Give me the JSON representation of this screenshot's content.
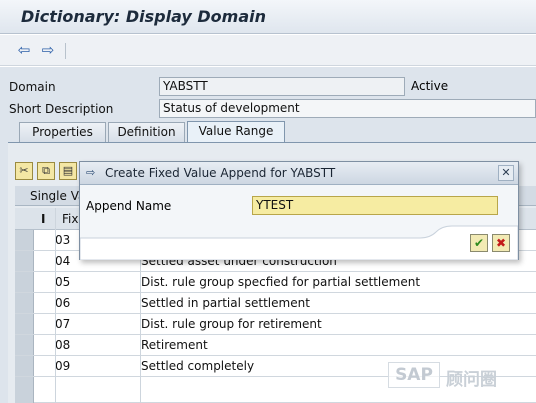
{
  "window": {
    "title": "Dictionary: Display Domain"
  },
  "toolbar": {
    "back_icon": "back-arrow-icon",
    "forward_icon": "forward-arrow-icon"
  },
  "form": {
    "domain_label": "Domain",
    "domain_value": "YABSTT",
    "status": "Active",
    "short_desc_label": "Short Description",
    "short_desc_value": "Status of development"
  },
  "tabs": [
    {
      "label": "Properties"
    },
    {
      "label": "Definition"
    },
    {
      "label": "Value Range",
      "active": true
    }
  ],
  "grid": {
    "section_title": "Single Va",
    "col_i": "I",
    "col_fix": "Fix.",
    "rows": [
      {
        "fix": "03",
        "text": ""
      },
      {
        "fix": "04",
        "text": "Settled asset under construction"
      },
      {
        "fix": "05",
        "text": "Dist. rule group specfied for partial settlement"
      },
      {
        "fix": "06",
        "text": "Settled in partial settlement"
      },
      {
        "fix": "07",
        "text": "Dist. rule group for retirement"
      },
      {
        "fix": "08",
        "text": "Retirement"
      },
      {
        "fix": "09",
        "text": "Settled completely"
      }
    ]
  },
  "dialog": {
    "title": "Create Fixed Value Append for YABSTT",
    "append_label": "Append Name",
    "append_value": "YTEST",
    "confirm_icon": "checkmark-icon",
    "cancel_icon": "cancel-x-icon"
  },
  "watermark": {
    "brand": "SAP",
    "text": "顾问圈"
  },
  "colors": {
    "title_bg": "#e8edf3",
    "panel_bg": "#dde4ec",
    "input_yellow": "#f6eca2",
    "accent_blue": "#2b5ea8"
  }
}
